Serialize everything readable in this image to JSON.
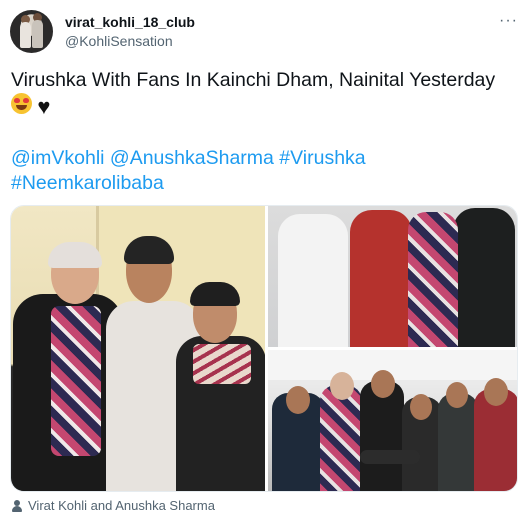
{
  "tweet": {
    "author_name": "virat_kohli_18_club",
    "author_handle": "@KohliSensation",
    "more_label": "···",
    "text_line": "Virushka With Fans In Kainchi Dham, Nainital Yesterday",
    "emojis": [
      "smiling-face-with-heart-eyes-icon",
      "black-heart-icon"
    ],
    "mentions": [
      "@imVkohli",
      "@AnushkaSharma"
    ],
    "hashtags": [
      "#Virushka",
      "#Neemkarolibaba"
    ],
    "media_count": 3,
    "tagged_people": "Virat Kohli and Anushka Sharma"
  },
  "colors": {
    "link": "#1d9bf0",
    "text": "#0f1419",
    "secondary": "#536471"
  }
}
